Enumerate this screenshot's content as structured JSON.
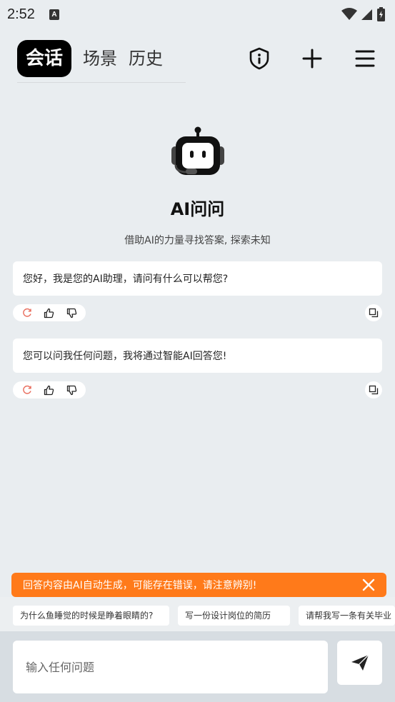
{
  "status_bar": {
    "time": "2:52",
    "notification_glyph": "A"
  },
  "header": {
    "tabs": [
      {
        "label": "会话",
        "active": true
      },
      {
        "label": "场景",
        "active": false
      },
      {
        "label": "历史",
        "active": false
      }
    ],
    "icons": [
      "shield-info-icon",
      "plus-icon",
      "menu-icon"
    ]
  },
  "hero": {
    "title": "AI问问",
    "subtitle": "借助AI的力量寻找答案, 探索未知"
  },
  "messages": [
    {
      "text": "您好，我是您的AI助理，请问有什么可以帮您?"
    },
    {
      "text": "您可以问我任何问题，我将通过智能AI回答您!"
    }
  ],
  "warning": {
    "text": "回答内容由AI自动生成，可能存在错误，请注意辨别!"
  },
  "suggestions": [
    "为什么鱼睡觉的时候是睁着眼睛的?",
    "写一份设计岗位的简历",
    "请帮我写一条有关毕业"
  ],
  "input": {
    "placeholder": "输入任何问题"
  },
  "colors": {
    "background": "#e9edf0",
    "warning": "#ff7a1a",
    "refresh_icon": "#e86a5a",
    "active_tab_bg": "#000000"
  }
}
